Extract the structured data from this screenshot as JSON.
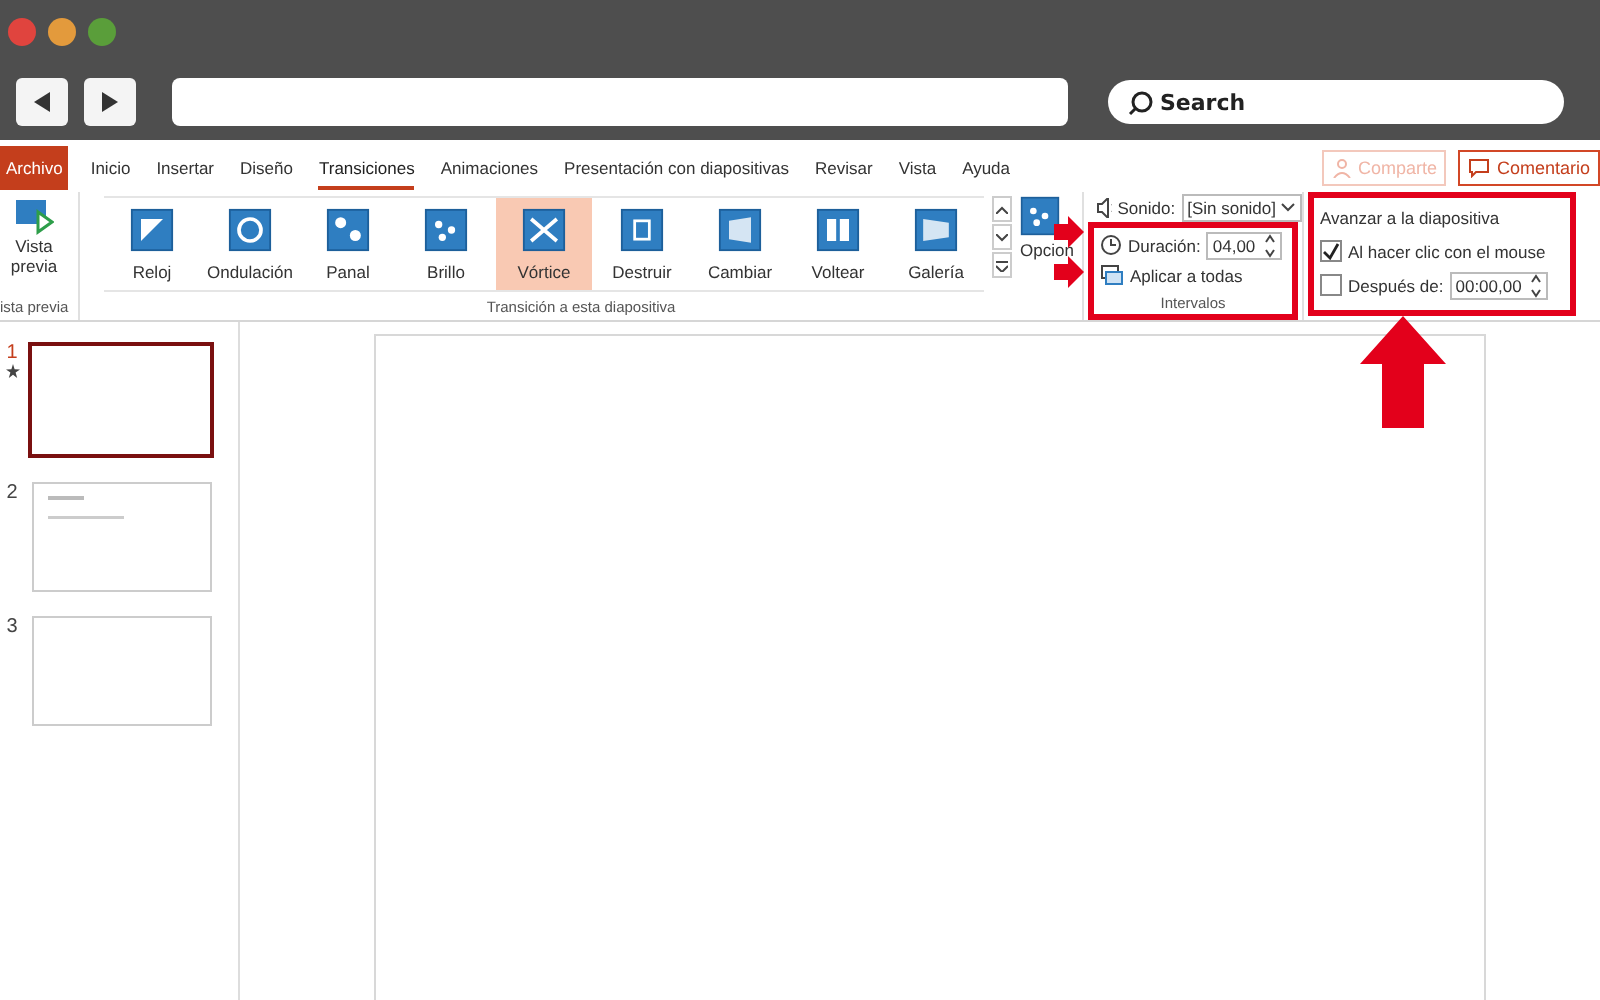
{
  "browser": {
    "search": {
      "placeholder": "Search"
    }
  },
  "ribbon": {
    "tabs": [
      {
        "label": "Archivo",
        "kind": "file",
        "selected": false
      },
      {
        "label": "Inicio",
        "kind": "tab",
        "selected": false
      },
      {
        "label": "Insertar",
        "kind": "tab",
        "selected": false
      },
      {
        "label": "Diseño",
        "kind": "tab",
        "selected": false
      },
      {
        "label": "Transiciones",
        "kind": "tab",
        "selected": true
      },
      {
        "label": "Animaciones",
        "kind": "tab",
        "selected": false
      },
      {
        "label": "Presentación con diapositivas",
        "kind": "tab",
        "selected": false
      },
      {
        "label": "Revisar",
        "kind": "tab",
        "selected": false
      },
      {
        "label": "Vista",
        "kind": "tab",
        "selected": false
      },
      {
        "label": "Ayuda",
        "kind": "tab",
        "selected": false
      }
    ],
    "actions": [
      {
        "label": "Comparte",
        "kind": "share",
        "disabled": true
      },
      {
        "label": "Comentario",
        "kind": "comment",
        "disabled": false
      }
    ],
    "preview": {
      "label": "Vista previa",
      "group": "ista previa"
    },
    "transitions": [
      {
        "label": "Reloj",
        "selected": false
      },
      {
        "label": "Ondulación",
        "selected": false
      },
      {
        "label": "Panal",
        "selected": false
      },
      {
        "label": "Brillo",
        "selected": false
      },
      {
        "label": "Vórtice",
        "selected": true
      },
      {
        "label": "Destruir",
        "selected": false
      },
      {
        "label": "Cambiar",
        "selected": false
      },
      {
        "label": "Voltear",
        "selected": false
      },
      {
        "label": "Galería",
        "selected": false
      }
    ],
    "gallery_group": "Transición a esta diapositiva",
    "effects_label": "Opcion",
    "sound": {
      "label": "Sonido:",
      "value": "[Sin sonido]"
    },
    "duration": {
      "label": "Duración:",
      "value": "04,00"
    },
    "apply_all": "Aplicar a todas",
    "timing_group": "Intervalos",
    "advance": {
      "title": "Avanzar a la diapositiva",
      "on_click": {
        "label": "Al hacer clic con el mouse",
        "checked": true
      },
      "after": {
        "label": "Después de:",
        "checked": false,
        "value": "00:00,00"
      }
    }
  },
  "slides": [
    {
      "number": "1",
      "selected": true,
      "transition": true,
      "kind": "blank"
    },
    {
      "number": "2",
      "selected": false,
      "transition": false,
      "kind": "text"
    },
    {
      "number": "3",
      "selected": false,
      "transition": false,
      "kind": "blank"
    }
  ]
}
